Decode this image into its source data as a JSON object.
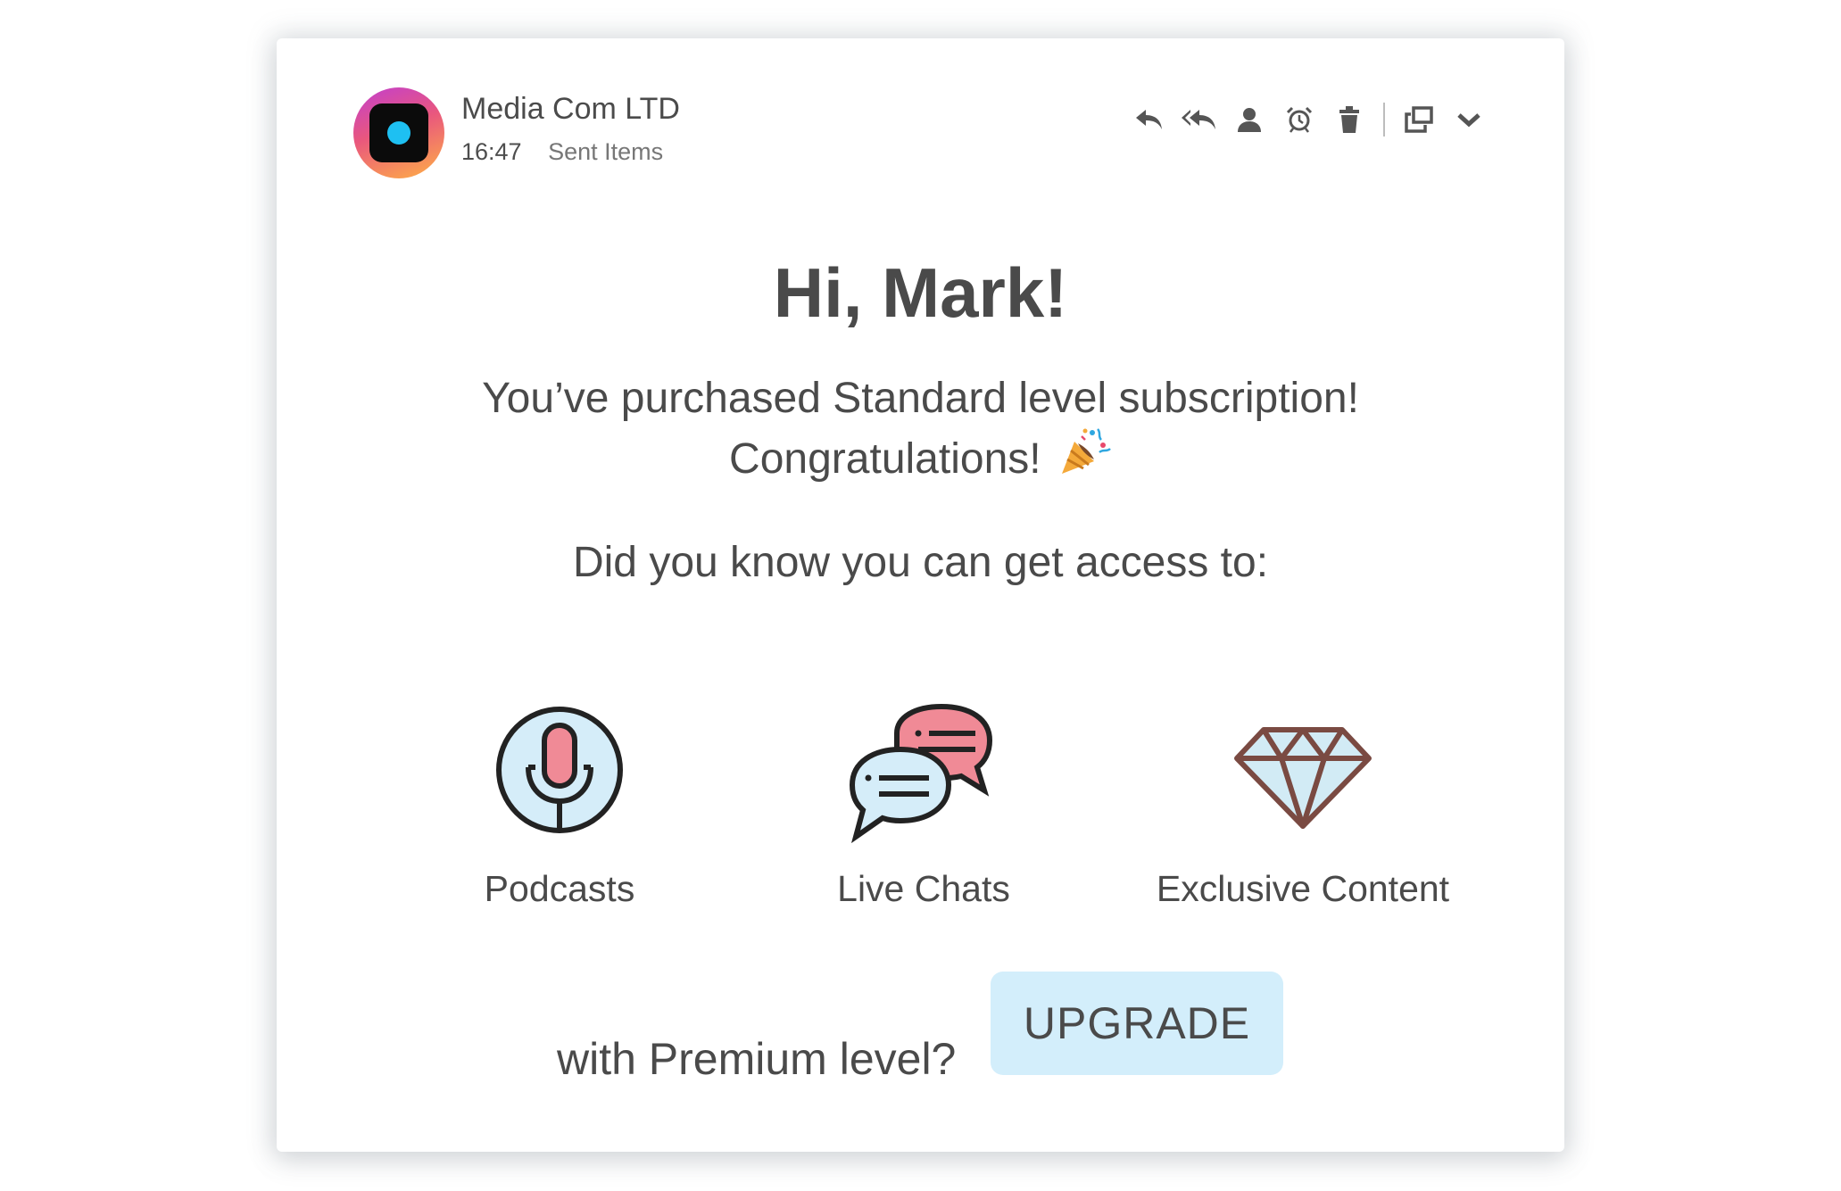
{
  "email": {
    "sender": "Media Com LTD",
    "time": "16:47",
    "folder": "Sent Items"
  },
  "toolbar": {
    "icons": [
      "reply-icon",
      "reply-all-icon",
      "person-icon",
      "alarm-clock-icon",
      "trash-icon",
      "popout-icon",
      "chevron-down-icon"
    ]
  },
  "body": {
    "greeting": "Hi, Mark!",
    "line1": "You’ve purchased Standard level subscription!",
    "line2": "Congratulations!",
    "line3": "Did you know you can get access to:",
    "features": [
      {
        "label": "Podcasts",
        "icon": "microphone-icon"
      },
      {
        "label": "Live Chats",
        "icon": "chat-bubbles-icon"
      },
      {
        "label": "Exclusive Content",
        "icon": "diamond-icon"
      }
    ],
    "premium_prompt": "with Premium level?",
    "upgrade_label": "UPGRADE"
  },
  "colors": {
    "upgrade_bg": "#d3eefb",
    "text": "#4a4a4a",
    "avatar_dot": "#1ec0f2",
    "chat_pink": "#f08a96",
    "chat_blue": "#d2ecf8"
  }
}
